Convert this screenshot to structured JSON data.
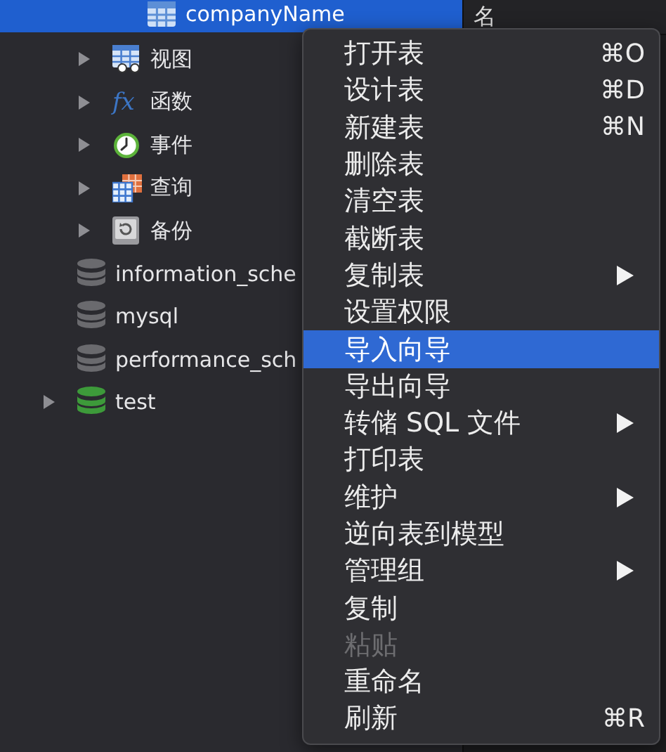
{
  "tree": [
    {
      "children": [
        {
          "children": [
            {
              "label": "companyName",
              "kind": "table",
              "selected": true
            }
          ]
        },
        {
          "label": "视图",
          "kind": "view",
          "expanded": false,
          "selected": false
        },
        {
          "label": "函数",
          "kind": "function",
          "glyph": "fx",
          "expanded": false,
          "selected": false
        },
        {
          "label": "事件",
          "kind": "event",
          "expanded": false,
          "selected": false
        },
        {
          "label": "查询",
          "kind": "query",
          "expanded": false,
          "selected": false
        },
        {
          "label": "备份",
          "kind": "backup",
          "expanded": false,
          "selected": false
        }
      ]
    },
    {
      "label": "information_sche",
      "kind": "database",
      "color": "#6a6a6e",
      "selected": false
    },
    {
      "label": "mysql",
      "kind": "database",
      "color": "#6a6a6e",
      "selected": false
    },
    {
      "label": "performance_sch",
      "kind": "database",
      "color": "#6a6a6e",
      "selected": false
    },
    {
      "label": "test",
      "kind": "database",
      "color": "#3d9a3a",
      "expanded": false,
      "selected": false
    }
  ],
  "header": {
    "column_1": "名"
  },
  "context_menu": [
    {
      "label": "打开表",
      "shortcut": "⌘O",
      "submenu": false,
      "disabled": false,
      "selected": false
    },
    {
      "label": "设计表",
      "shortcut": "⌘D",
      "submenu": false,
      "disabled": false,
      "selected": false
    },
    {
      "label": "新建表",
      "shortcut": "⌘N",
      "submenu": false,
      "disabled": false,
      "selected": false
    },
    {
      "label": "删除表",
      "submenu": false,
      "disabled": false,
      "selected": false
    },
    {
      "label": "清空表",
      "submenu": false,
      "disabled": false,
      "selected": false
    },
    {
      "label": "截断表",
      "submenu": false,
      "disabled": false,
      "selected": false
    },
    {
      "label": "复制表",
      "submenu": true,
      "disabled": false,
      "selected": false
    },
    {
      "label": "设置权限",
      "submenu": false,
      "disabled": false,
      "selected": false
    },
    {
      "label": "导入向导",
      "submenu": false,
      "disabled": false,
      "selected": true
    },
    {
      "label": "导出向导",
      "submenu": false,
      "disabled": false,
      "selected": false
    },
    {
      "label": "转储 SQL 文件",
      "submenu": true,
      "disabled": false,
      "selected": false
    },
    {
      "label": "打印表",
      "submenu": false,
      "disabled": false,
      "selected": false
    },
    {
      "label": "维护",
      "submenu": true,
      "disabled": false,
      "selected": false
    },
    {
      "label": "逆向表到模型",
      "submenu": false,
      "disabled": false,
      "selected": false
    },
    {
      "label": "管理组",
      "submenu": true,
      "disabled": false,
      "selected": false
    },
    {
      "label": "复制",
      "submenu": false,
      "disabled": false,
      "selected": false
    },
    {
      "label": "粘贴",
      "submenu": false,
      "disabled": true,
      "selected": false
    },
    {
      "label": "重命名",
      "submenu": false,
      "disabled": false,
      "selected": false
    },
    {
      "label": "刷新",
      "shortcut": "⌘R",
      "submenu": false,
      "disabled": false,
      "selected": false
    }
  ]
}
